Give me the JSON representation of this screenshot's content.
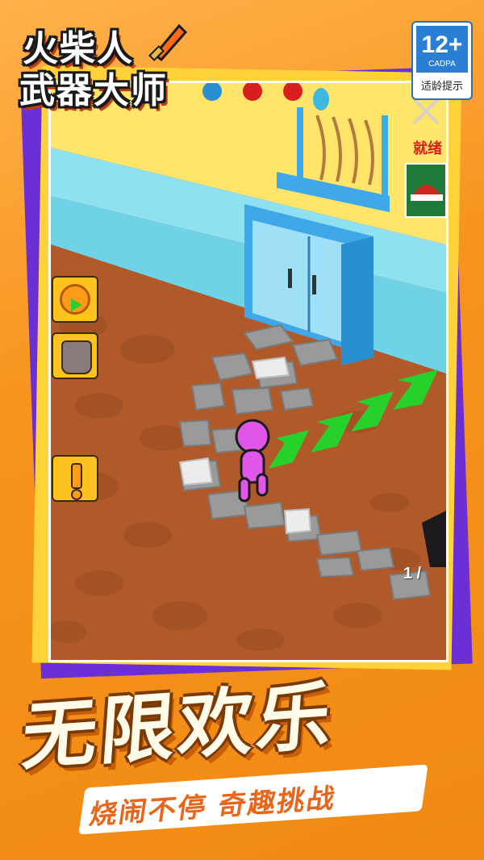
{
  "logo": {
    "line1": "火柴人",
    "line2": "武器大师"
  },
  "age_rating": {
    "age": "12+",
    "org": "CADPA",
    "hint": "适龄提示"
  },
  "game": {
    "status_label": "就绪",
    "counter": "1 /",
    "side_buttons": [
      "speed-boost-icon",
      "armor-icon",
      "alert-icon"
    ]
  },
  "banner": {
    "title": "无限欢乐",
    "subtitle": "烧闹不停   奇趣挑战"
  },
  "colors": {
    "background": "#f7931e",
    "frame_purple": "#6b2fd6",
    "frame_yellow": "#ffd23a",
    "floor": "#b05a2a",
    "wall": "#8fe0f0",
    "character": "#e056e8",
    "arrows": "#27d12c"
  }
}
